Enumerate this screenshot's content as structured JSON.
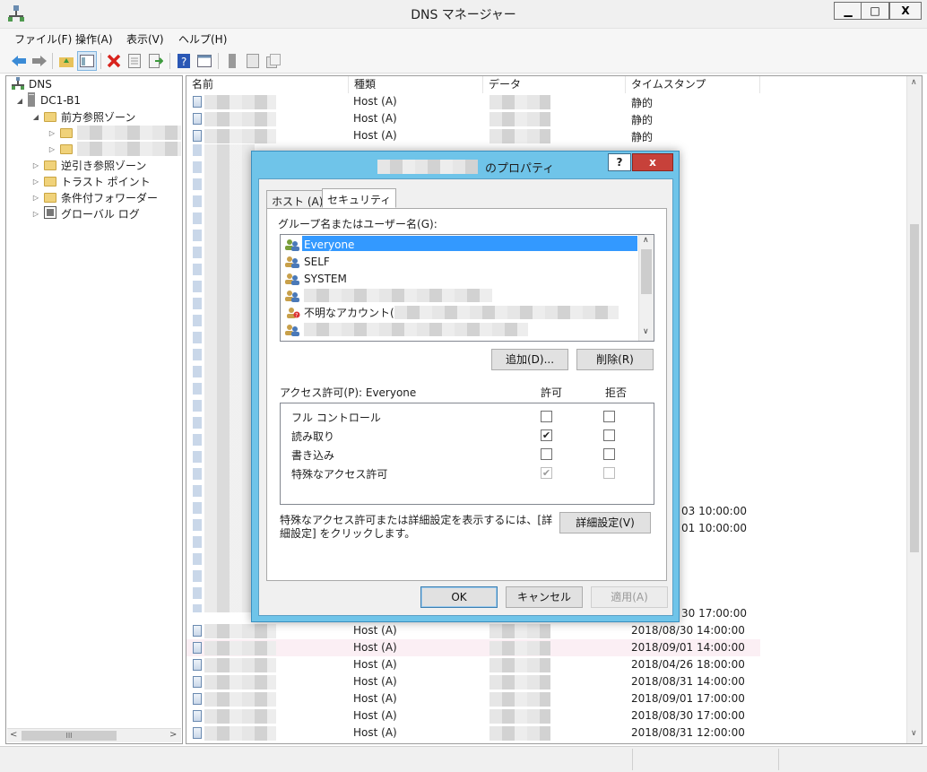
{
  "window": {
    "title": "DNS マネージャー",
    "min_label": "▁",
    "max_label": "□",
    "close_label": "X"
  },
  "menu": [
    "ファイル(F)",
    "操作(A)",
    "表示(V)",
    "ヘルプ(H)"
  ],
  "tree": {
    "root": "DNS",
    "server": "DC1-B1",
    "forward": "前方参照ゾーン",
    "reverse": "逆引き参照ゾーン",
    "trust": "トラスト ポイント",
    "conditional": "条件付フォワーダー",
    "global_log": "グローバル ログ",
    "scroll_label": "III"
  },
  "list": {
    "columns": [
      "名前",
      "種類",
      "データ",
      "タイムスタンプ"
    ],
    "rows_top": [
      {
        "type": "Host (A)",
        "timestamp": "静的"
      },
      {
        "type": "Host (A)",
        "timestamp": "静的"
      },
      {
        "type": "Host (A)",
        "timestamp": "静的"
      }
    ],
    "partial_timestamps": [
      "03 10:00:00",
      "01 10:00:00",
      "30 17:00:00"
    ],
    "rows_bottom": [
      {
        "type": "Host (A)",
        "timestamp": "2018/08/30 14:00:00"
      },
      {
        "type": "Host (A)",
        "timestamp": "2018/09/01 14:00:00"
      },
      {
        "type": "Host (A)",
        "timestamp": "2018/04/26 18:00:00"
      },
      {
        "type": "Host (A)",
        "timestamp": "2018/08/31 14:00:00"
      },
      {
        "type": "Host (A)",
        "timestamp": "2018/09/01 17:00:00"
      },
      {
        "type": "Host (A)",
        "timestamp": "2018/08/30 17:00:00"
      },
      {
        "type": "Host (A)",
        "timestamp": "2018/08/31 12:00:00"
      }
    ]
  },
  "dialog": {
    "title_suffix": "のプロパティ",
    "help": "?",
    "close": "x",
    "tabs": [
      "ホスト (A)",
      "セキュリティ"
    ],
    "group_label": "グループ名またはユーザー名(G):",
    "groups": [
      "Everyone",
      "SELF",
      "SYSTEM",
      "",
      "不明なアカウント("
    ],
    "add_button": "追加(D)...",
    "remove_button": "削除(R)",
    "perm_label": "アクセス許可(P): Everyone",
    "allow_header": "許可",
    "deny_header": "拒否",
    "permissions": [
      {
        "name": "フル コントロール",
        "allow": false,
        "deny": false,
        "disabled": false
      },
      {
        "name": "読み取り",
        "allow": true,
        "deny": false,
        "disabled": false
      },
      {
        "name": "書き込み",
        "allow": false,
        "deny": false,
        "disabled": false
      },
      {
        "name": "特殊なアクセス許可",
        "allow": true,
        "deny": false,
        "disabled": true
      }
    ],
    "advanced_text_1": "特殊なアクセス許可または詳細設定を表示するには、[詳",
    "advanced_text_2": "細設定] をクリックします。",
    "advanced_button": "詳細設定(V)",
    "ok": "OK",
    "cancel": "キャンセル",
    "apply": "適用(A)"
  }
}
